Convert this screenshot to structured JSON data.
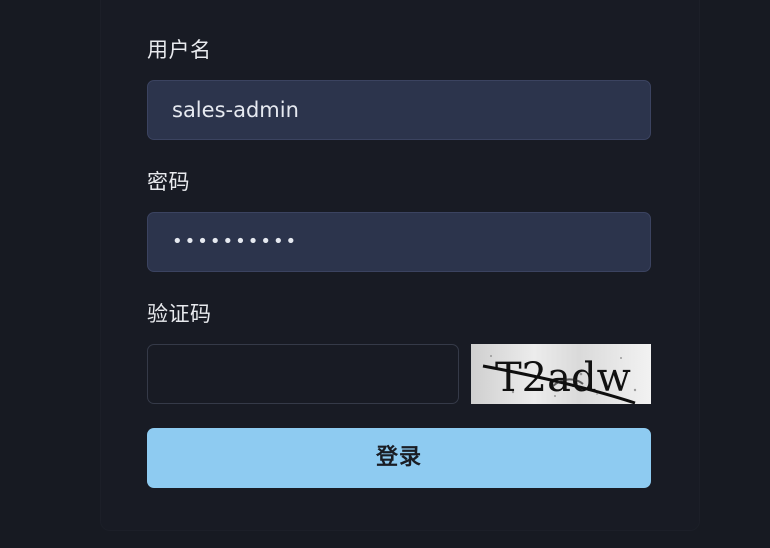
{
  "form": {
    "username_label": "用户名",
    "username_value": "sales-admin",
    "password_label": "密码",
    "password_value": "••••••••••",
    "captcha_label": "验证码",
    "captcha_value": "",
    "captcha_text": "T2adw",
    "login_label": "登录"
  },
  "colors": {
    "background": "#171a22",
    "input_fill": "#2c344c",
    "button_fill": "#8ecbf1"
  }
}
